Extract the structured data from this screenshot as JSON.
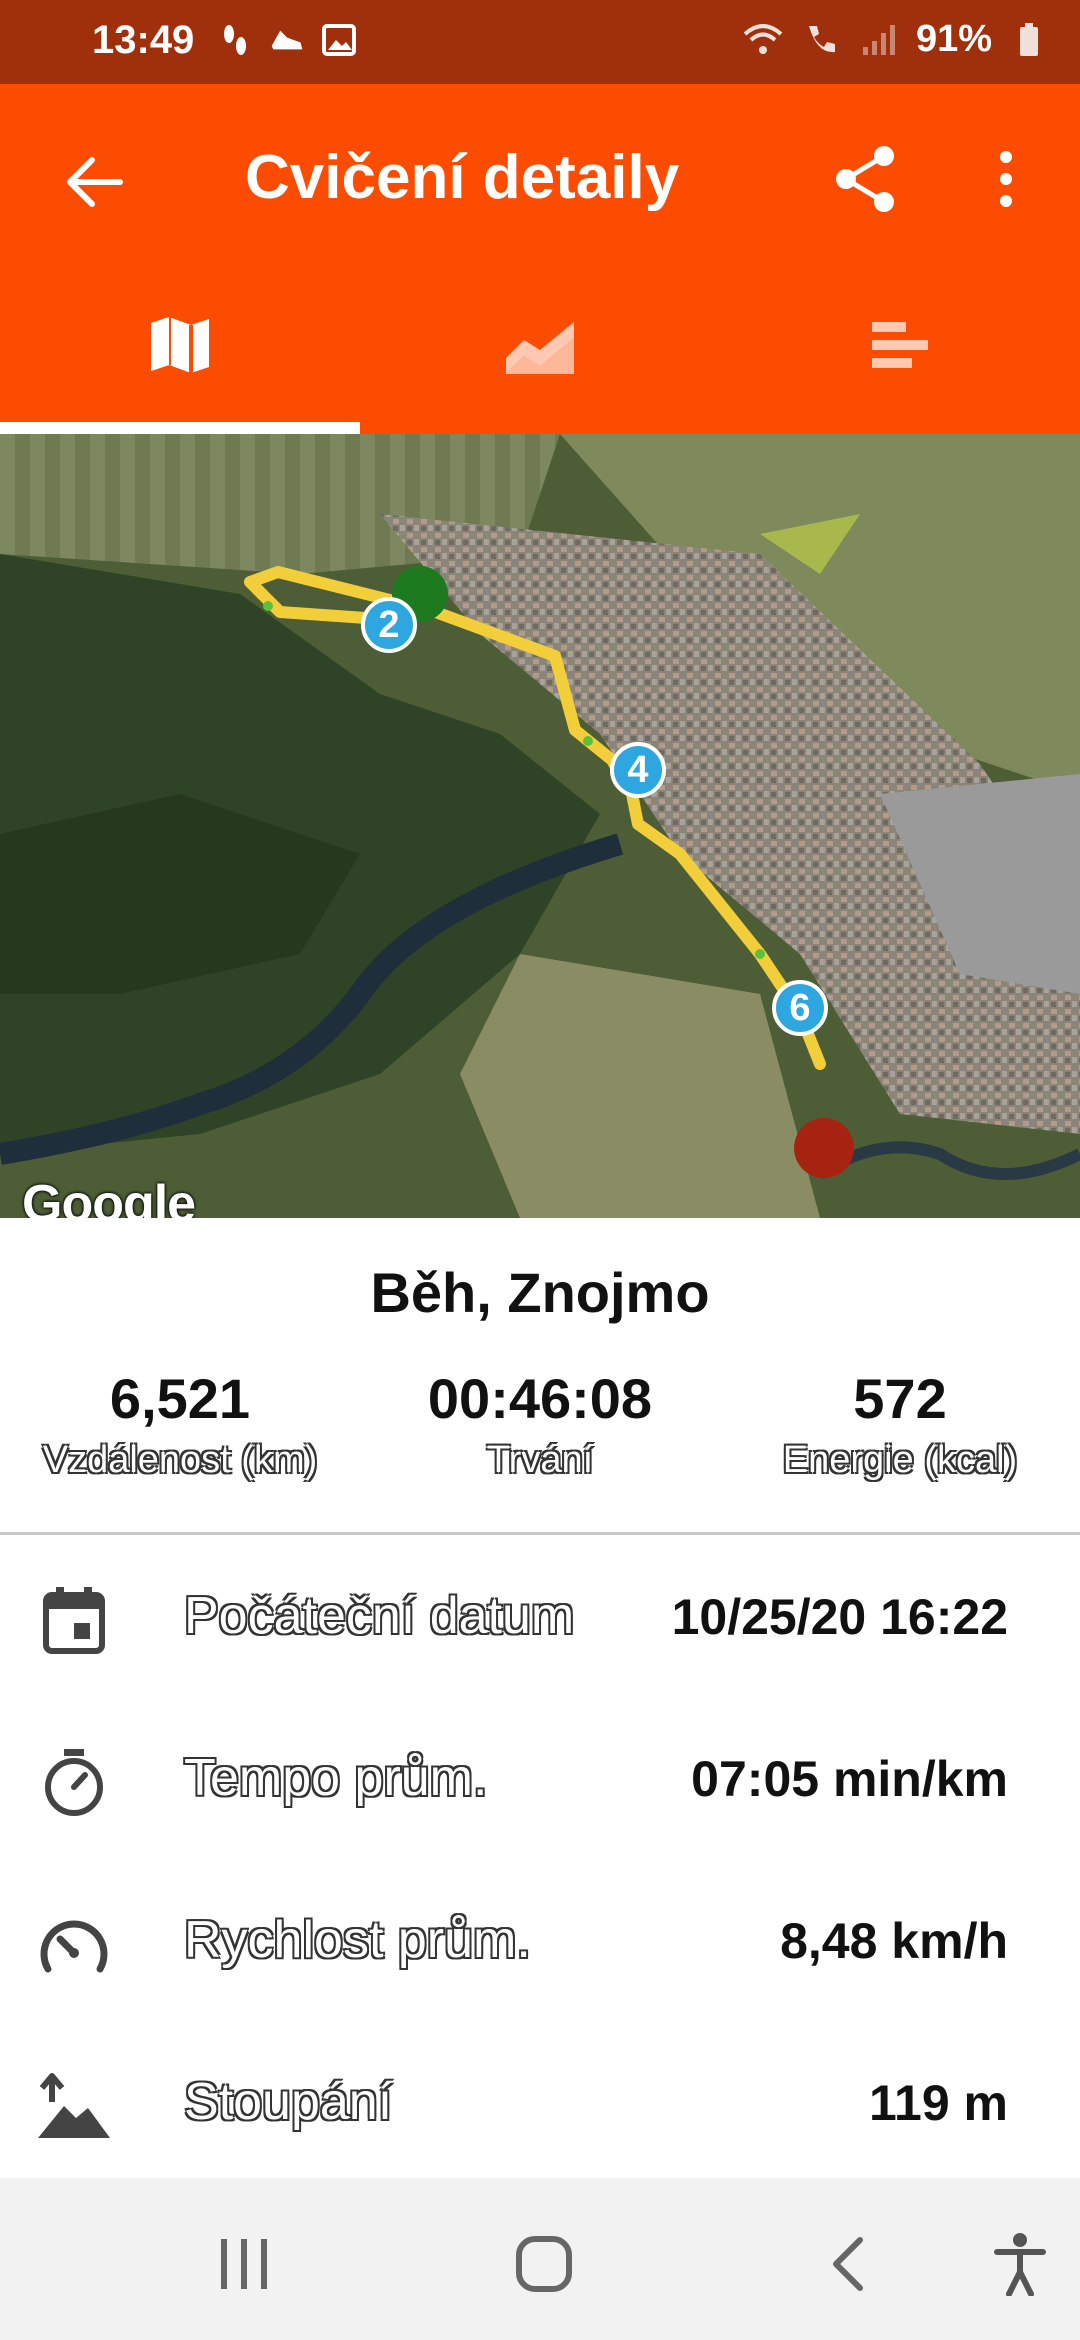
{
  "status_bar": {
    "time": "13:49",
    "battery": "91%",
    "icons": [
      "footsteps-icon",
      "shoe-icon",
      "image-icon",
      "wifi-icon",
      "call-icon",
      "signal-icon",
      "battery-icon"
    ]
  },
  "app_bar": {
    "title": "Cvičení detaily",
    "back_icon": "arrow-back-icon",
    "share_icon": "share-icon",
    "more_icon": "more-vert-icon",
    "accent": "#fc4c02"
  },
  "tabs": [
    {
      "icon": "map-icon",
      "active": true
    },
    {
      "icon": "chart-icon",
      "active": false
    },
    {
      "icon": "bars-icon",
      "active": false
    }
  ],
  "map": {
    "attribution": "Google",
    "markers": [
      "2",
      "4",
      "6"
    ],
    "route_color": "#f5d547",
    "start_color": "#1e7a1e",
    "end_color": "#a52310"
  },
  "summary": {
    "title": "Běh,  Znojmo",
    "stats": [
      {
        "value": "6,521",
        "label": "Vzdálenost (km)"
      },
      {
        "value": "00:46:08",
        "label": "Trvání"
      },
      {
        "value": "572",
        "label": "Energie (kcal)"
      }
    ]
  },
  "details": [
    {
      "icon": "calendar-icon",
      "label": "Počáteční datum",
      "value": "10/25/20 16:22"
    },
    {
      "icon": "stopwatch-icon",
      "label": "Tempo prům.",
      "value": "07:05 min/km"
    },
    {
      "icon": "speedometer-icon",
      "label": "Rychlost prům.",
      "value": "8,48 km/h"
    },
    {
      "icon": "elevation-icon",
      "label": "Stoupání",
      "value": "119 m"
    }
  ],
  "nav_bar": {
    "icons": [
      "recent-apps-icon",
      "home-icon",
      "back-icon",
      "accessibility-icon"
    ]
  }
}
